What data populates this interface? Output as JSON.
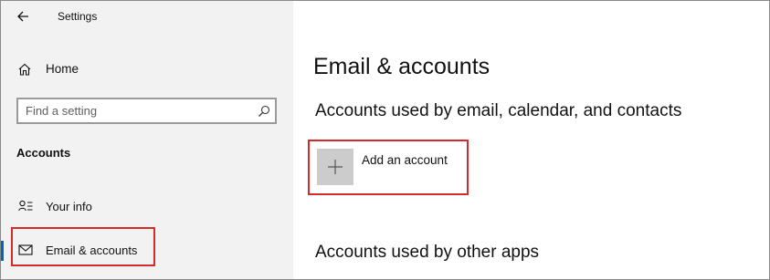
{
  "window": {
    "title": "Settings"
  },
  "sidebar": {
    "home_label": "Home",
    "search": {
      "placeholder": "Find a setting",
      "value": ""
    },
    "section_heading": "Accounts",
    "items": [
      {
        "label": "Your info",
        "icon": "person-list-icon",
        "selected": false
      },
      {
        "label": "Email & accounts",
        "icon": "mail-icon",
        "selected": true
      }
    ]
  },
  "main": {
    "title": "Email & accounts",
    "email_section_heading": "Accounts used by email, calendar, and contacts",
    "add_account_label": "Add an account",
    "other_apps_heading": "Accounts used by other apps"
  },
  "colors": {
    "sidebar_bg": "#f2f2f2",
    "accent": "#0067c0",
    "highlight_outline": "#d52b2b",
    "tile_bg": "#cccccc"
  }
}
